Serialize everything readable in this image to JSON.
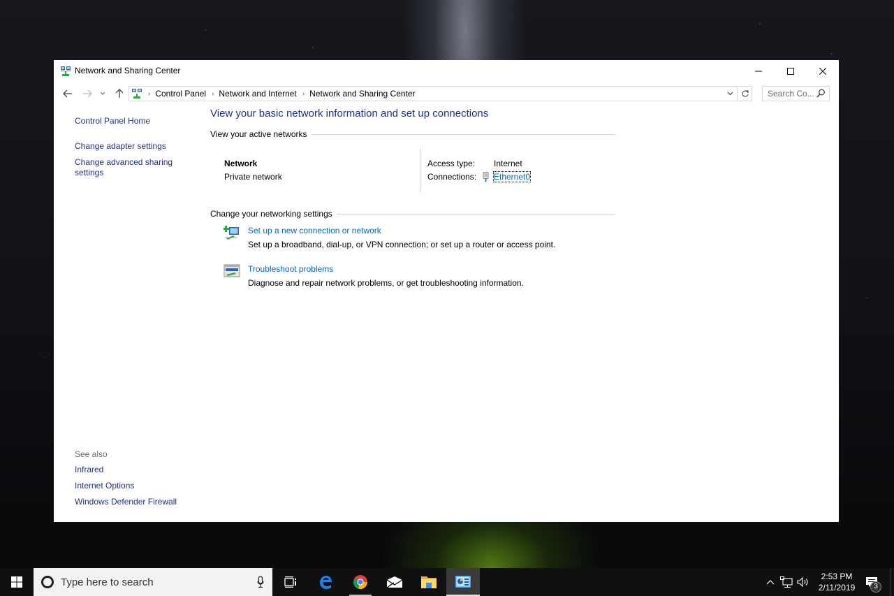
{
  "window": {
    "title": "Network and Sharing Center",
    "controls": {
      "minimize": "minimize",
      "maximize": "maximize",
      "close": "close"
    }
  },
  "navigation": {
    "back": "back",
    "forward": "forward",
    "recent": "recent-locations",
    "up": "up",
    "breadcrumb": [
      "Control Panel",
      "Network and Internet",
      "Network and Sharing Center"
    ],
    "search_placeholder": "Search Co..."
  },
  "left_pane": {
    "links": [
      "Control Panel Home",
      "Change adapter settings",
      "Change advanced sharing settings"
    ],
    "see_also_label": "See also",
    "see_also": [
      "Infrared",
      "Internet Options",
      "Windows Defender Firewall"
    ]
  },
  "main": {
    "title": "View your basic network information and set up connections",
    "active_networks_heading": "View your active networks",
    "network": {
      "name": "Network",
      "category": "Private network",
      "access_type_label": "Access type:",
      "access_type": "Internet",
      "connections_label": "Connections:",
      "connection": "Ethernet0"
    },
    "settings_heading": "Change your networking settings",
    "settings": [
      {
        "title": "Set up a new connection or network",
        "description": "Set up a broadband, dial-up, or VPN connection; or set up a router or access point."
      },
      {
        "title": "Troubleshoot problems",
        "description": "Diagnose and repair network problems, or get troubleshooting information."
      }
    ]
  },
  "taskbar": {
    "search_placeholder": "Type here to search",
    "apps": [
      "Task View",
      "Microsoft Edge",
      "Google Chrome",
      "Mail",
      "File Explorer",
      "Network and Sharing Center"
    ],
    "clock": {
      "time": "2:53 PM",
      "date": "2/11/2019"
    },
    "notification_count": "3"
  }
}
